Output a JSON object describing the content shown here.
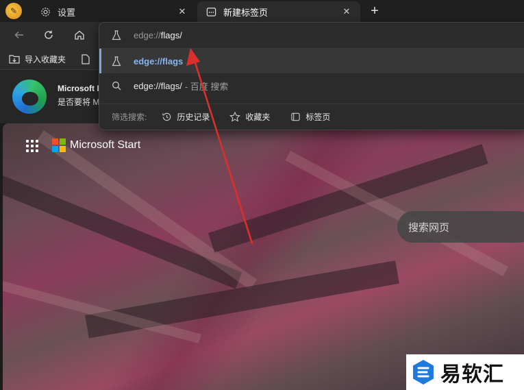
{
  "tabs": [
    {
      "label": "设置",
      "icon": "gear-icon",
      "active": false
    },
    {
      "label": "新建标签页",
      "icon": "newtab-page-icon",
      "active": true
    }
  ],
  "tab_close_glyph": "✕",
  "new_tab_glyph": "+",
  "toolbar": {
    "back_icon": "arrow-left-icon",
    "refresh_icon": "refresh-icon",
    "home_icon": "home-icon"
  },
  "favorites": [
    {
      "label": "导入收藏夹",
      "icon": "import-favorites-icon"
    },
    {
      "label": "",
      "icon": "document-icon"
    }
  ],
  "notice": {
    "title": "Microsoft E",
    "text": "是否要将 M"
  },
  "omnibox": {
    "scheme": "edge://",
    "host": "flags/",
    "suggestions": [
      {
        "text": "edge://flags",
        "icon": "flask-icon",
        "selected": true
      },
      {
        "text": "edge://flags/",
        "suffix": "- 百度 搜索",
        "icon": "search-icon",
        "selected": false
      }
    ],
    "filter_label": "筛选搜索:",
    "filters": [
      {
        "label": "历史记录",
        "icon": "history-icon"
      },
      {
        "label": "收藏夹",
        "icon": "star-icon"
      },
      {
        "label": "标签页",
        "icon": "tabs-icon"
      }
    ]
  },
  "newtab": {
    "brand": "Microsoft Start",
    "search_placeholder": "搜索网页"
  },
  "watermark": {
    "text": "易软汇"
  },
  "colors": {
    "accent": "#88b4f0",
    "annotation": "#d9302c",
    "ms_red": "#f25022",
    "ms_green": "#7fba00",
    "ms_blue": "#00a4ef",
    "ms_yellow": "#ffb900"
  }
}
